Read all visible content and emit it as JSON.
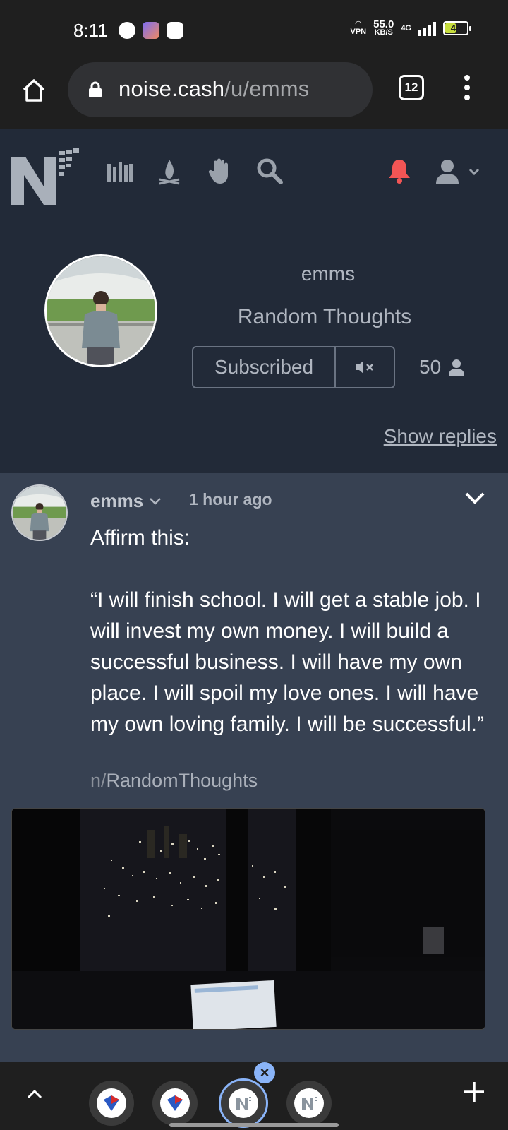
{
  "status_bar": {
    "time": "8:11",
    "vpn_label": "VPN",
    "speed_value": "55.0",
    "speed_unit": "KB/S",
    "network": "4G",
    "battery": "47"
  },
  "browser": {
    "url_host": "noise.cash",
    "url_path": "/u/emms",
    "tab_count": "12"
  },
  "site_nav": {
    "icons": [
      "library-icon",
      "campfire-icon",
      "hand-icon",
      "search-icon",
      "bell-icon",
      "user-icon"
    ],
    "bell_color": "#f25555"
  },
  "profile": {
    "username": "emms",
    "channel_title": "Random Thoughts",
    "subscribe_label": "Subscribed",
    "subscriber_count": "50",
    "show_replies": "Show replies"
  },
  "post": {
    "author": "emms",
    "time": "1 hour ago",
    "paragraphs": [
      "Affirm this:",
      "“I will finish school. I will get a stable job. I will invest my own money. I will build a successful business. I will have my own place. I will spoil my love ones. I will have my own loving family. I will be successful.”"
    ],
    "channel_prefix": "n/",
    "channel_name": "RandomThoughts"
  },
  "tab_switcher": {
    "tabs": [
      "tab-1",
      "tab-2",
      "tab-3-active",
      "tab-4"
    ],
    "active_index": 2
  },
  "colors": {
    "page_bg": "#374152",
    "header_bg": "#222a38",
    "chrome_bg": "#1f1f1f",
    "accent": "#8ab4f8"
  }
}
